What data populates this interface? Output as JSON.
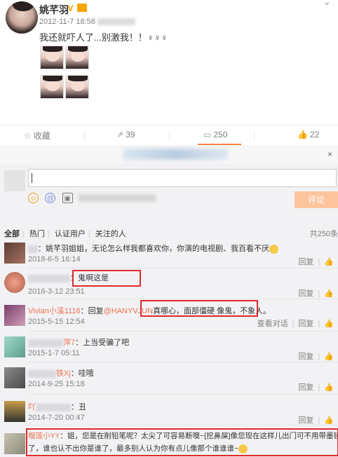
{
  "post": {
    "author": "姚芊羽",
    "verified": "V",
    "time": "2012-11-7 18:58",
    "text": "我还就吓人了...别激我！！♀♀♀",
    "photo_count": 4
  },
  "actions": {
    "favorite": "收藏",
    "repost": "39",
    "comment": "250",
    "like": "22"
  },
  "composer": {
    "close": "×",
    "submit": "评论"
  },
  "filters": {
    "all": "全部",
    "hot": "热门",
    "verified": "认证用户",
    "following": "关注的人",
    "total": "共250条"
  },
  "labels": {
    "reply": "回复",
    "view_conversation": "查看对话",
    "like_icon": "👍"
  },
  "comments": [
    {
      "name": "Ji",
      "text": "：姚芊羽姐姐，无论怎么样我都喜欢你，你演的电视剧、我百看不厌",
      "time": "2018-6-5 16:14"
    },
    {
      "name": "jiji",
      "text": "：鬼啊这是",
      "time": "2016-3-12 23:51"
    },
    {
      "name": "Vivian小溪1116",
      "text": "：回复",
      "mention": "@HANYVJUN",
      "rest": "真哪心，面部僵硬 像鬼，不象人。",
      "time": "2015-5-15 12:54"
    },
    {
      "name": "萍7",
      "text": "：上当受骗了吧",
      "time": "2015-1-7 05:11"
    },
    {
      "name": "铁Xj",
      "text": "：哇哦",
      "time": "2014-9-25 15:18"
    },
    {
      "name": "吖",
      "text": "：丑",
      "time": "2014-7-20 00:47"
    },
    {
      "name": "榴莲小YY",
      "text": "：姐，您是在削铅笔呢？太尖了可容易断噢~[挖鼻屎]像您现在这样儿出门可不用带墨镜",
      "text2": "了，谁也认不出你是谁了，最多别人认为你有点儿像那个谁谁谁~"
    }
  ]
}
